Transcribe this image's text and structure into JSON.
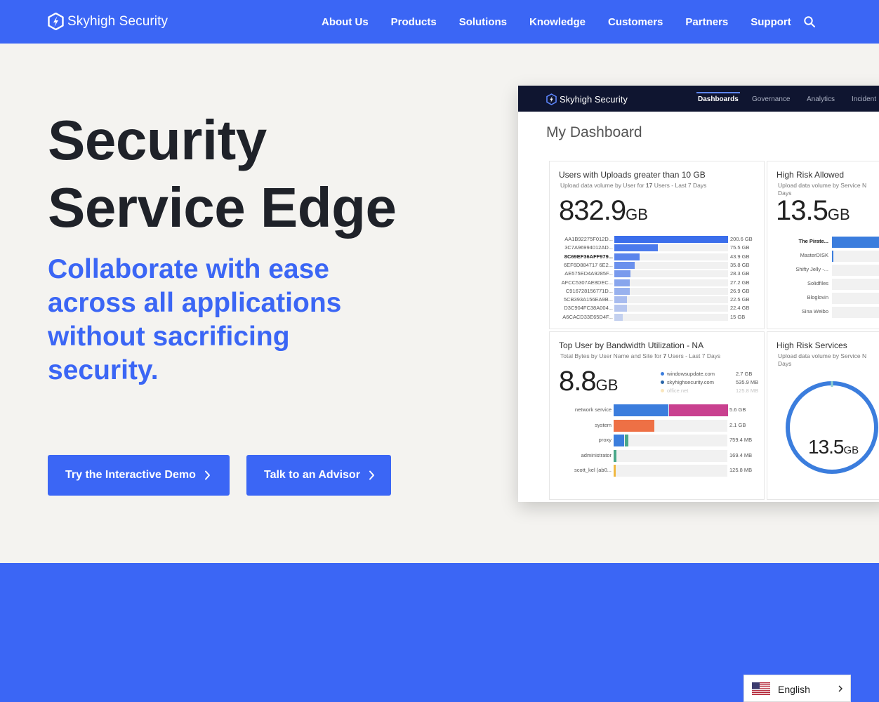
{
  "header": {
    "brand": "Skyhigh Security",
    "nav": [
      "About Us",
      "Products",
      "Solutions",
      "Knowledge",
      "Customers",
      "Partners",
      "Support"
    ],
    "search_icon": "search-icon"
  },
  "hero": {
    "title_line1": "Security",
    "title_line2": "Service Edge",
    "subtitle": "Collaborate with ease across all applications without sacrificing security.",
    "btn_demo": "Try the Interactive Demo",
    "btn_advisor": "Talk to an Advisor"
  },
  "dashboard": {
    "brand": "Skyhigh Security",
    "tabs": [
      "Dashboards",
      "Governance",
      "Analytics",
      "Incident"
    ],
    "heading": "My Dashboard",
    "panel1": {
      "title": "Users with Uploads greater than 10 GB",
      "sub_prefix": "Upload data volume by User for ",
      "sub_count": "17",
      "sub_suffix": " Users - Last 7 Days",
      "big_value": "832.9",
      "big_unit": "GB",
      "rows": [
        {
          "label": "AA1B92275F012D...",
          "value": "200.6 GB",
          "pct": 1.0
        },
        {
          "label": "3C7A96994012AD...",
          "value": "75.5 GB",
          "pct": 0.38
        },
        {
          "label": "8C69EF36AFF979...",
          "value": "43.9 GB",
          "pct": 0.22,
          "bold": true
        },
        {
          "label": "6EF6D884717 6E2...",
          "value": "35.8 GB",
          "pct": 0.18
        },
        {
          "label": "AE575ED4A9285F...",
          "value": "28.3 GB",
          "pct": 0.14
        },
        {
          "label": "AFCC5307AE8DEC...",
          "value": "27.2 GB",
          "pct": 0.135
        },
        {
          "label": "C916728156771D...",
          "value": "26.9 GB",
          "pct": 0.134
        },
        {
          "label": "5CB393A156EA9B...",
          "value": "22.5 GB",
          "pct": 0.112
        },
        {
          "label": "D3C904FC38A004...",
          "value": "22.4 GB",
          "pct": 0.111
        },
        {
          "label": "A6CACD33E65D4F...",
          "value": "15 GB",
          "pct": 0.075
        }
      ]
    },
    "panel2": {
      "title": "High Risk Allowed",
      "sub": "Upload data volume by Service N",
      "sub2": "Days",
      "big_value": "13.5",
      "big_unit": "GB",
      "rows": [
        "The Pirate...",
        "MasterDISK",
        "Shifty Jelly -...",
        "Solidfiles",
        "Bloglovin",
        "Sina Weibo"
      ]
    },
    "panel3": {
      "title": "Top User by Bandwidth Utilization - NA",
      "sub_prefix": "Total Bytes by User Name and Site for ",
      "sub_count": "7",
      "sub_suffix": " Users - Last 7 Days",
      "big_value": "8.8",
      "big_unit": "GB",
      "legend": [
        {
          "name": "windowsupdate.com",
          "value": "2.7 GB",
          "color": "#3b7ddd"
        },
        {
          "name": "skyhighsecurity.com",
          "value": "535.9 MB",
          "color": "#2a66a8"
        },
        {
          "name": "office.net",
          "value": "125.8 MB",
          "color": "#f0b840"
        }
      ],
      "rows": [
        {
          "label": "network service",
          "value": "5.6 GB"
        },
        {
          "label": "system",
          "value": "2.1 GB"
        },
        {
          "label": "proxy",
          "value": "759.4 MB"
        },
        {
          "label": "administrator",
          "value": "169.4 MB"
        },
        {
          "label": "scott_kel (ab0...",
          "value": "125.8 MB"
        }
      ]
    },
    "panel4": {
      "title": "High Risk Services",
      "sub": "Upload data volume by Service N",
      "sub2": "Days",
      "big_value": "13.5",
      "big_unit": "GB"
    }
  },
  "language": {
    "label": "English",
    "flag_icon": "us-flag-icon"
  },
  "colors": {
    "brand_blue": "#3b66f5",
    "title_dark": "#1f2229",
    "hero_bg": "#f4f3f0"
  }
}
